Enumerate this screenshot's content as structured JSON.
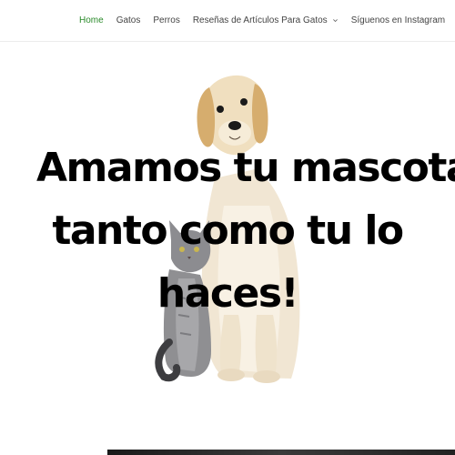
{
  "nav": {
    "items": [
      {
        "label": "Home",
        "active": true
      },
      {
        "label": "Gatos",
        "active": false
      },
      {
        "label": "Perros",
        "active": false
      },
      {
        "label": "Reseñas de Artículos Para Gatos",
        "active": false,
        "has_dropdown": true
      },
      {
        "label": "Síguenos en Instagram",
        "active": false
      }
    ],
    "active_color": "#2a8a2a"
  },
  "hero": {
    "title_lines": [
      "Amamos tu mascota,",
      "tanto como tu lo",
      "haces!"
    ],
    "image": "golden-retriever-puppy-and-grey-kitten"
  }
}
